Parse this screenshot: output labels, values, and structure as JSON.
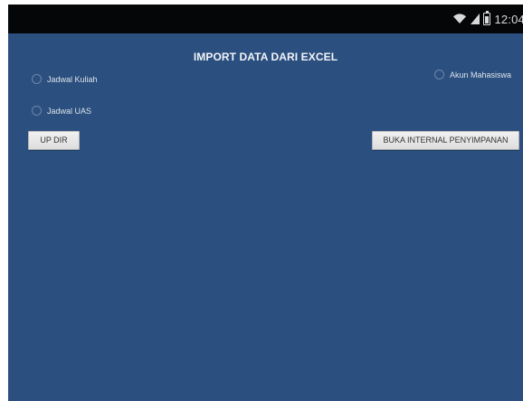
{
  "status": {
    "time": "12:04",
    "icons": [
      "wifi-icon",
      "signal-icon",
      "battery-icon"
    ]
  },
  "screen": {
    "title": "IMPORT DATA DARI EXCEL"
  },
  "options": {
    "jadwal_kuliah": "Jadwal Kuliah",
    "jadwal_uas": "Jadwal UAS",
    "akun_mahasiswa": "Akun Mahasiswa"
  },
  "buttons": {
    "up_dir": "UP DIR",
    "buka_internal": "BUKA INTERNAL PENYIMPANAN"
  },
  "colors": {
    "app_background": "#2b4f7f",
    "status_bar": "#050608",
    "button_background": "#e8e8e8"
  }
}
